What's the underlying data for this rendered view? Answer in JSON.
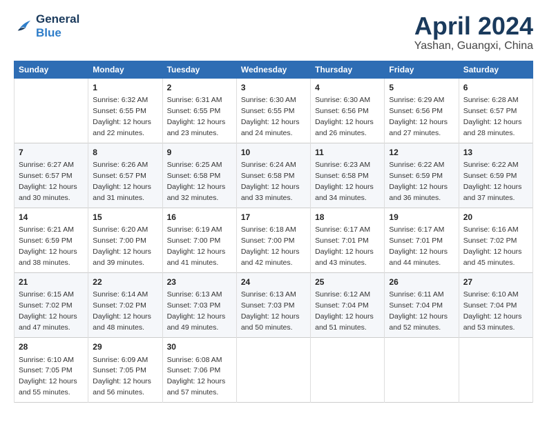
{
  "header": {
    "logo_line1": "General",
    "logo_line2": "Blue",
    "title": "April 2024",
    "subtitle": "Yashan, Guangxi, China"
  },
  "columns": [
    "Sunday",
    "Monday",
    "Tuesday",
    "Wednesday",
    "Thursday",
    "Friday",
    "Saturday"
  ],
  "weeks": [
    [
      {
        "day": "",
        "content": ""
      },
      {
        "day": "1",
        "content": "Sunrise: 6:32 AM\nSunset: 6:55 PM\nDaylight: 12 hours\nand 22 minutes."
      },
      {
        "day": "2",
        "content": "Sunrise: 6:31 AM\nSunset: 6:55 PM\nDaylight: 12 hours\nand 23 minutes."
      },
      {
        "day": "3",
        "content": "Sunrise: 6:30 AM\nSunset: 6:55 PM\nDaylight: 12 hours\nand 24 minutes."
      },
      {
        "day": "4",
        "content": "Sunrise: 6:30 AM\nSunset: 6:56 PM\nDaylight: 12 hours\nand 26 minutes."
      },
      {
        "day": "5",
        "content": "Sunrise: 6:29 AM\nSunset: 6:56 PM\nDaylight: 12 hours\nand 27 minutes."
      },
      {
        "day": "6",
        "content": "Sunrise: 6:28 AM\nSunset: 6:57 PM\nDaylight: 12 hours\nand 28 minutes."
      }
    ],
    [
      {
        "day": "7",
        "content": "Sunrise: 6:27 AM\nSunset: 6:57 PM\nDaylight: 12 hours\nand 30 minutes."
      },
      {
        "day": "8",
        "content": "Sunrise: 6:26 AM\nSunset: 6:57 PM\nDaylight: 12 hours\nand 31 minutes."
      },
      {
        "day": "9",
        "content": "Sunrise: 6:25 AM\nSunset: 6:58 PM\nDaylight: 12 hours\nand 32 minutes."
      },
      {
        "day": "10",
        "content": "Sunrise: 6:24 AM\nSunset: 6:58 PM\nDaylight: 12 hours\nand 33 minutes."
      },
      {
        "day": "11",
        "content": "Sunrise: 6:23 AM\nSunset: 6:58 PM\nDaylight: 12 hours\nand 34 minutes."
      },
      {
        "day": "12",
        "content": "Sunrise: 6:22 AM\nSunset: 6:59 PM\nDaylight: 12 hours\nand 36 minutes."
      },
      {
        "day": "13",
        "content": "Sunrise: 6:22 AM\nSunset: 6:59 PM\nDaylight: 12 hours\nand 37 minutes."
      }
    ],
    [
      {
        "day": "14",
        "content": "Sunrise: 6:21 AM\nSunset: 6:59 PM\nDaylight: 12 hours\nand 38 minutes."
      },
      {
        "day": "15",
        "content": "Sunrise: 6:20 AM\nSunset: 7:00 PM\nDaylight: 12 hours\nand 39 minutes."
      },
      {
        "day": "16",
        "content": "Sunrise: 6:19 AM\nSunset: 7:00 PM\nDaylight: 12 hours\nand 41 minutes."
      },
      {
        "day": "17",
        "content": "Sunrise: 6:18 AM\nSunset: 7:00 PM\nDaylight: 12 hours\nand 42 minutes."
      },
      {
        "day": "18",
        "content": "Sunrise: 6:17 AM\nSunset: 7:01 PM\nDaylight: 12 hours\nand 43 minutes."
      },
      {
        "day": "19",
        "content": "Sunrise: 6:17 AM\nSunset: 7:01 PM\nDaylight: 12 hours\nand 44 minutes."
      },
      {
        "day": "20",
        "content": "Sunrise: 6:16 AM\nSunset: 7:02 PM\nDaylight: 12 hours\nand 45 minutes."
      }
    ],
    [
      {
        "day": "21",
        "content": "Sunrise: 6:15 AM\nSunset: 7:02 PM\nDaylight: 12 hours\nand 47 minutes."
      },
      {
        "day": "22",
        "content": "Sunrise: 6:14 AM\nSunset: 7:02 PM\nDaylight: 12 hours\nand 48 minutes."
      },
      {
        "day": "23",
        "content": "Sunrise: 6:13 AM\nSunset: 7:03 PM\nDaylight: 12 hours\nand 49 minutes."
      },
      {
        "day": "24",
        "content": "Sunrise: 6:13 AM\nSunset: 7:03 PM\nDaylight: 12 hours\nand 50 minutes."
      },
      {
        "day": "25",
        "content": "Sunrise: 6:12 AM\nSunset: 7:04 PM\nDaylight: 12 hours\nand 51 minutes."
      },
      {
        "day": "26",
        "content": "Sunrise: 6:11 AM\nSunset: 7:04 PM\nDaylight: 12 hours\nand 52 minutes."
      },
      {
        "day": "27",
        "content": "Sunrise: 6:10 AM\nSunset: 7:04 PM\nDaylight: 12 hours\nand 53 minutes."
      }
    ],
    [
      {
        "day": "28",
        "content": "Sunrise: 6:10 AM\nSunset: 7:05 PM\nDaylight: 12 hours\nand 55 minutes."
      },
      {
        "day": "29",
        "content": "Sunrise: 6:09 AM\nSunset: 7:05 PM\nDaylight: 12 hours\nand 56 minutes."
      },
      {
        "day": "30",
        "content": "Sunrise: 6:08 AM\nSunset: 7:06 PM\nDaylight: 12 hours\nand 57 minutes."
      },
      {
        "day": "",
        "content": ""
      },
      {
        "day": "",
        "content": ""
      },
      {
        "day": "",
        "content": ""
      },
      {
        "day": "",
        "content": ""
      }
    ]
  ]
}
